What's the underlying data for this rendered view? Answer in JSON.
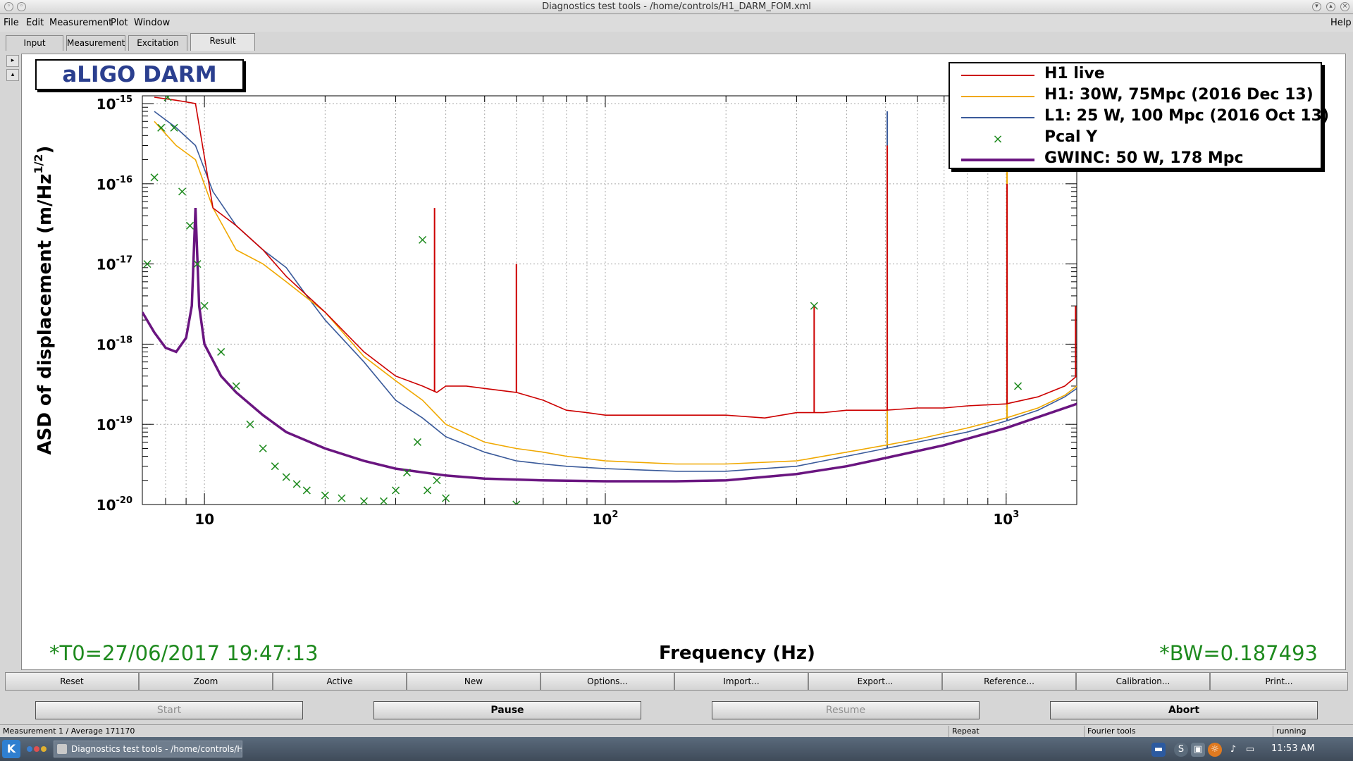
{
  "window": {
    "title": "Diagnostics test tools - /home/controls/H1_DARM_FOM.xml"
  },
  "menu": [
    {
      "label": "File"
    },
    {
      "label": "Edit"
    },
    {
      "label": "Measurement"
    },
    {
      "label": "Plot"
    },
    {
      "label": "Window"
    },
    {
      "label": "Help"
    }
  ],
  "tabs": [
    {
      "label": "Input"
    },
    {
      "label": "Measurement"
    },
    {
      "label": "Excitation"
    },
    {
      "label": "Result"
    }
  ],
  "side_arrows": {
    "up": "▸",
    "down": "▴"
  },
  "plot": {
    "badge": "aLIGO DARM",
    "t0": "*T0=27/06/2017 19:47:13",
    "bw": "*BW=0.187493",
    "xlabel": "Frequency (Hz)",
    "ylabel": "ASD of displacement (m/Hz",
    "ylabel_sup": "1/2",
    "ylabel_end": ")"
  },
  "chart_data": {
    "type": "line",
    "xscale": "log",
    "yscale": "log",
    "xlim": [
      7,
      1500
    ],
    "ylim": [
      1e-20,
      1.25e-15
    ],
    "grid": true,
    "legend_position": "top-right",
    "xlabel": "Frequency (Hz)",
    "ylabel": "ASD of displacement (m/Hz^1/2)",
    "x_ticks": [
      {
        "value": 10,
        "base": "10",
        "exp": ""
      },
      {
        "value": 100,
        "base": "10",
        "exp": "2"
      },
      {
        "value": 1000,
        "base": "10",
        "exp": "3"
      }
    ],
    "y_ticks": [
      {
        "value": 1e-15,
        "base": "10",
        "exp": "-15"
      },
      {
        "value": 1e-16,
        "base": "10",
        "exp": "-16"
      },
      {
        "value": 1e-17,
        "base": "10",
        "exp": "-17"
      },
      {
        "value": 1e-18,
        "base": "10",
        "exp": "-18"
      },
      {
        "value": 1e-19,
        "base": "10",
        "exp": "-19"
      },
      {
        "value": 1e-20,
        "base": "10",
        "exp": "-20"
      }
    ],
    "series": [
      {
        "name": "H1 live",
        "color": "#cc0000",
        "style": "line",
        "x": [
          7.5,
          8.5,
          9.5,
          10.5,
          12,
          14,
          16,
          20,
          25,
          30,
          35,
          38,
          40,
          45,
          50,
          60,
          70,
          80,
          90,
          100,
          120,
          150,
          200,
          250,
          300,
          350,
          400,
          500,
          600,
          700,
          800,
          1000,
          1200,
          1400,
          1500
        ],
        "y": [
          1.2e-15,
          1.1e-15,
          1e-15,
          5e-17,
          3e-17,
          1.5e-17,
          7e-18,
          2.5e-18,
          8e-19,
          4e-19,
          3e-19,
          2.5e-19,
          3e-19,
          3e-19,
          2.8e-19,
          2.5e-19,
          2e-19,
          1.5e-19,
          1.4e-19,
          1.3e-19,
          1.3e-19,
          1.3e-19,
          1.3e-19,
          1.2e-19,
          1.4e-19,
          1.4e-19,
          1.5e-19,
          1.5e-19,
          1.6e-19,
          1.6e-19,
          1.7e-19,
          1.8e-19,
          2.2e-19,
          3e-19,
          4e-19
        ],
        "peaks": [
          {
            "x": 37.5,
            "y": 5e-17
          },
          {
            "x": 60,
            "y": 1e-17
          },
          {
            "x": 331.9,
            "y": 3e-18
          },
          {
            "x": 505,
            "y": 3e-16
          },
          {
            "x": 1005,
            "y": 1e-16
          },
          {
            "x": 1490,
            "y": 3e-18
          }
        ]
      },
      {
        "name": "H1: 30W, 75Mpc (2016 Dec 13)",
        "color": "#f0a800",
        "style": "line",
        "x": [
          7.5,
          8.5,
          9.5,
          10.5,
          12,
          14,
          16,
          20,
          25,
          30,
          35,
          40,
          50,
          60,
          70,
          80,
          100,
          150,
          200,
          300,
          400,
          500,
          600,
          800,
          1000,
          1200,
          1400,
          1500
        ],
        "y": [
          6e-16,
          3e-16,
          2e-16,
          5e-17,
          1.5e-17,
          1e-17,
          6e-18,
          2.5e-18,
          7e-19,
          3.5e-19,
          2e-19,
          1e-19,
          6e-20,
          5e-20,
          4.5e-20,
          4e-20,
          3.5e-20,
          3.2e-20,
          3.2e-20,
          3.5e-20,
          4.5e-20,
          5.5e-20,
          6.5e-20,
          9e-20,
          1.2e-19,
          1.6e-19,
          2.3e-19,
          3e-19
        ],
        "peaks": [
          {
            "x": 505,
            "y": 3e-16
          },
          {
            "x": 1005,
            "y": 2e-16
          }
        ]
      },
      {
        "name": "L1: 25 W, 100 Mpc (2016 Oct 13)",
        "color": "#3a5a9a",
        "style": "line",
        "x": [
          7.5,
          8.5,
          9.5,
          10.5,
          12,
          14,
          16,
          18,
          20,
          25,
          30,
          35,
          40,
          50,
          60,
          70,
          80,
          100,
          150,
          200,
          300,
          400,
          500,
          600,
          800,
          1000,
          1200,
          1400,
          1500
        ],
        "y": [
          8e-16,
          5e-16,
          3e-16,
          8e-17,
          3e-17,
          1.5e-17,
          9e-18,
          4e-18,
          2e-18,
          6e-19,
          2e-19,
          1.2e-19,
          7e-20,
          4.5e-20,
          3.5e-20,
          3.2e-20,
          3e-20,
          2.8e-20,
          2.6e-20,
          2.6e-20,
          3e-20,
          4e-20,
          5e-20,
          6e-20,
          8e-20,
          1.1e-19,
          1.5e-19,
          2.2e-19,
          2.8e-19
        ],
        "peaks": [
          {
            "x": 505,
            "y": 8e-16
          },
          {
            "x": 1005,
            "y": 1e-17
          }
        ]
      },
      {
        "name": "Pcal Y",
        "color": "#1e8a1e",
        "style": "markers",
        "x": [
          7.2,
          7.5,
          7.8,
          8.1,
          8.4,
          8.8,
          9.2,
          9.6,
          10,
          11,
          12,
          13,
          14,
          15,
          16,
          17,
          18,
          20,
          22,
          25,
          28,
          30,
          32,
          34,
          35,
          36,
          38,
          40,
          60,
          331.9,
          1070
        ],
        "y": [
          1e-17,
          1.2e-16,
          5e-16,
          1.2e-15,
          5e-16,
          8e-17,
          3e-17,
          1e-17,
          3e-18,
          8e-19,
          3e-19,
          1e-19,
          5e-20,
          3e-20,
          2.2e-20,
          1.8e-20,
          1.5e-20,
          1.3e-20,
          1.2e-20,
          1.1e-20,
          1.1e-20,
          1.5e-20,
          2.5e-20,
          6e-20,
          2e-17,
          1.5e-20,
          2e-20,
          1.2e-20,
          1e-20,
          3e-18,
          3e-19
        ]
      },
      {
        "name": "GWINC: 50 W, 178 Mpc",
        "color": "#6a1580",
        "style": "line",
        "x": [
          7,
          7.5,
          8,
          8.5,
          9,
          9.3,
          9.5,
          9.7,
          10,
          11,
          12,
          14,
          16,
          20,
          25,
          30,
          40,
          50,
          70,
          100,
          150,
          200,
          300,
          400,
          500,
          700,
          1000,
          1500
        ],
        "y": [
          2.5e-18,
          1.4e-18,
          9e-19,
          8e-19,
          1.2e-18,
          3e-18,
          5e-17,
          3e-18,
          1e-18,
          4e-19,
          2.5e-19,
          1.3e-19,
          8e-20,
          5e-20,
          3.5e-20,
          2.8e-20,
          2.3e-20,
          2.1e-20,
          2e-20,
          1.95e-20,
          1.95e-20,
          2e-20,
          2.4e-20,
          3e-20,
          3.8e-20,
          5.5e-20,
          9e-20,
          1.8e-19
        ]
      }
    ]
  },
  "buttons_row1": [
    {
      "label": "Reset"
    },
    {
      "label": "Zoom"
    },
    {
      "label": "Active"
    },
    {
      "label": "New"
    },
    {
      "label": "Options..."
    },
    {
      "label": "Import..."
    },
    {
      "label": "Export..."
    },
    {
      "label": "Reference..."
    },
    {
      "label": "Calibration..."
    },
    {
      "label": "Print..."
    }
  ],
  "buttons_row2": [
    {
      "label": "Start",
      "enabled": false
    },
    {
      "label": "Pause",
      "enabled": true
    },
    {
      "label": "Resume",
      "enabled": false
    },
    {
      "label": "Abort",
      "enabled": true
    }
  ],
  "status": {
    "left": "Measurement 1 / Average 171170",
    "repeat": "Repeat",
    "tool": "Fourier tools",
    "state": "running"
  },
  "taskbar": {
    "start_glyph": "K",
    "task_label": "Diagnostics test tools - /home/controls/H1",
    "tray": [
      {
        "icon": "display-icon",
        "glyph": "▬"
      },
      {
        "icon": "s-icon",
        "glyph": "S"
      },
      {
        "icon": "clipboard-icon",
        "glyph": "▣"
      },
      {
        "icon": "firefox-icon",
        "glyph": "☼"
      },
      {
        "icon": "volume-icon",
        "glyph": "♪"
      },
      {
        "icon": "network-icon",
        "glyph": "▭"
      }
    ],
    "clock": "11:53 AM"
  }
}
